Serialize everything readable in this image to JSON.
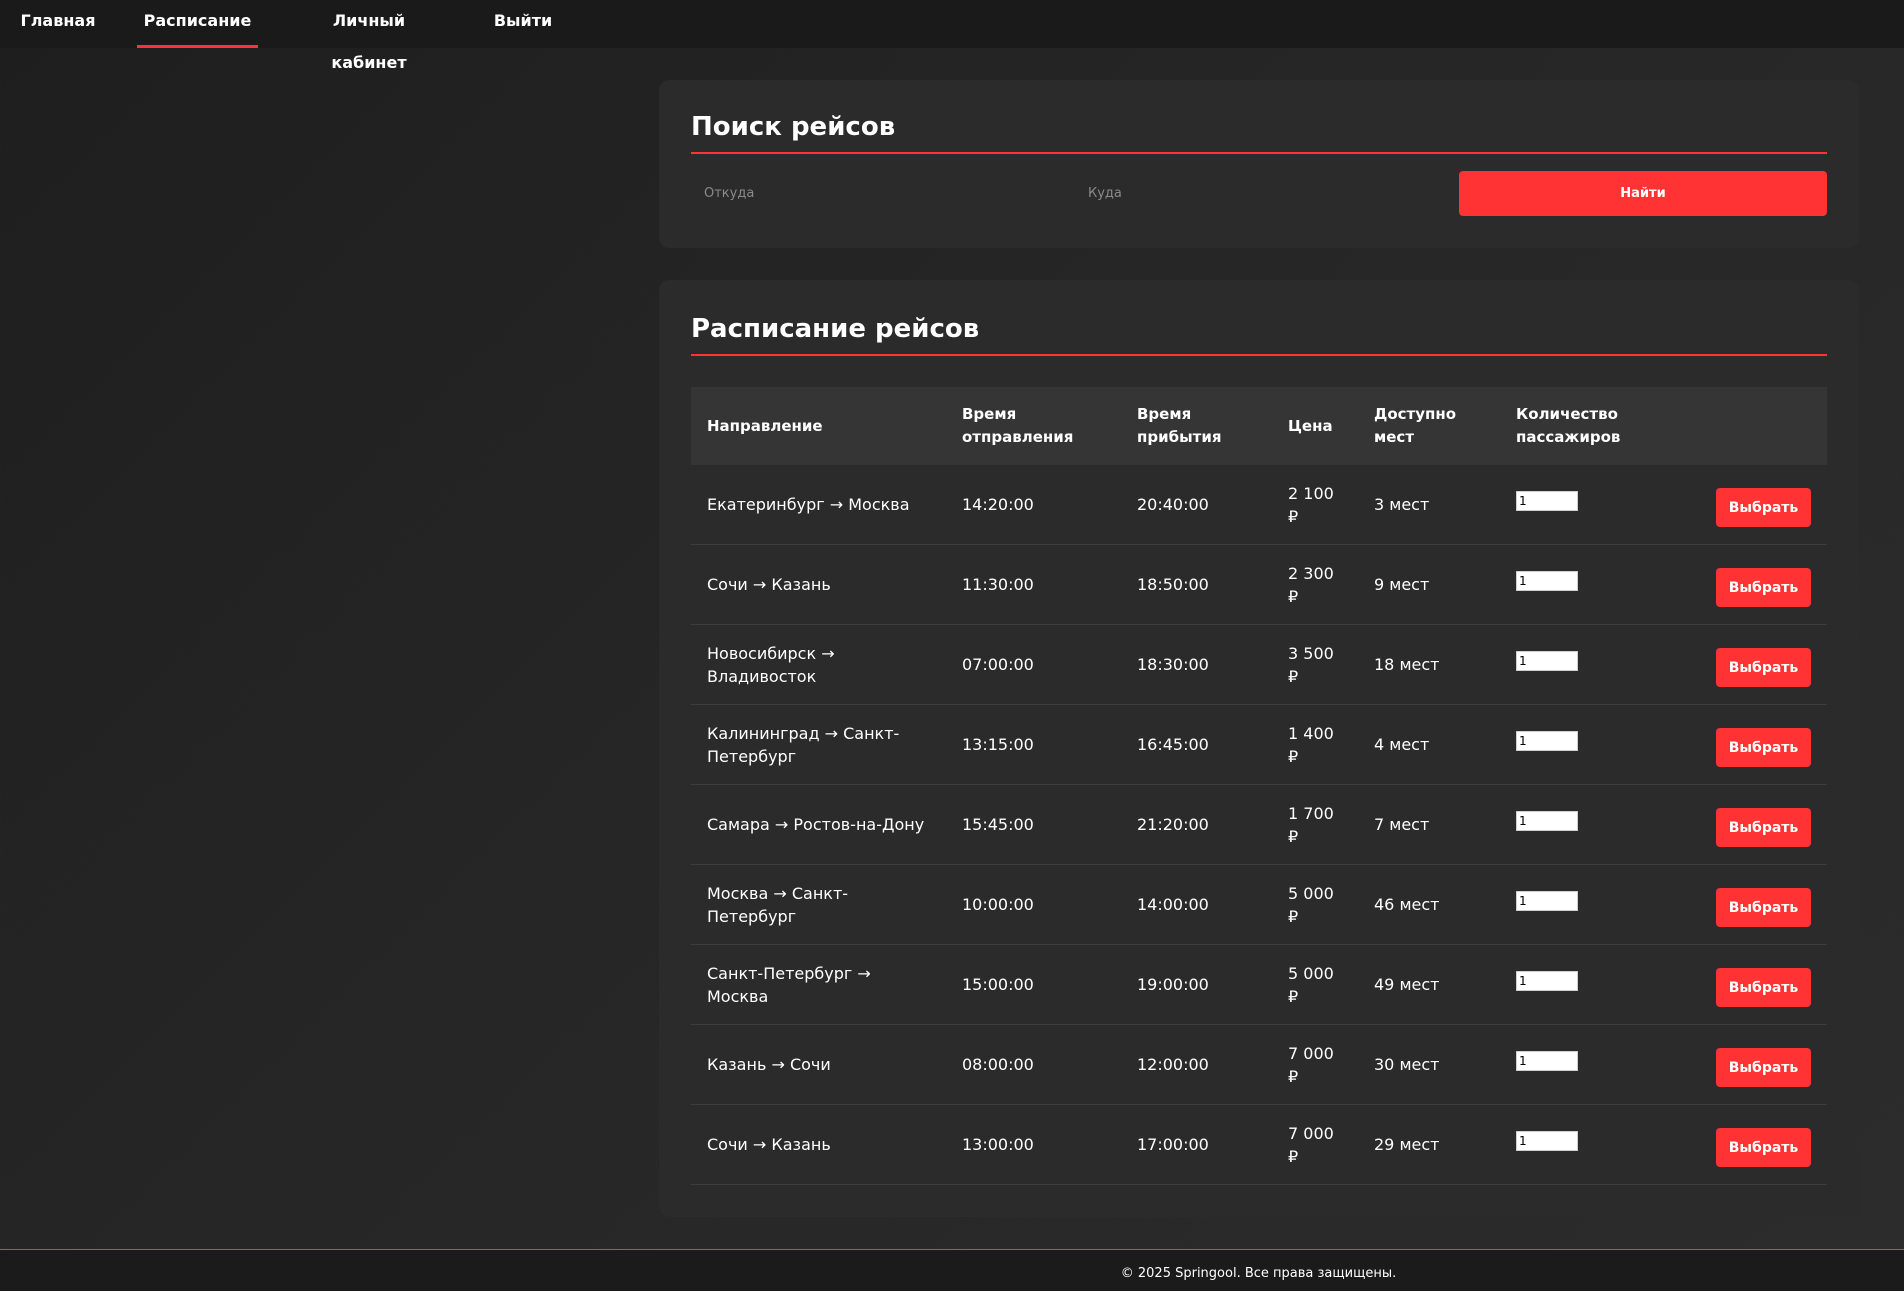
{
  "nav": {
    "items": [
      {
        "label": "Главная",
        "active": false
      },
      {
        "label": "Расписание",
        "active": true
      },
      {
        "label": "Личный кабинет",
        "active": false
      },
      {
        "label": "Выйти",
        "active": false
      }
    ]
  },
  "search": {
    "title": "Поиск рейсов",
    "from_placeholder": "Откуда",
    "from_value": "",
    "to_placeholder": "Куда",
    "to_value": "",
    "button_label": "Найти"
  },
  "schedule": {
    "title": "Расписание рейсов",
    "headers": [
      "Направление",
      "Время отправления",
      "Время прибытия",
      "Цена",
      "Доступно мест",
      "Количество пассажиров",
      ""
    ],
    "rows": [
      {
        "route": "Екатеринбург → Москва",
        "departure": "14:20:00",
        "arrival": "20:40:00",
        "price": "2 100 ₽",
        "seats": "3 мест",
        "qty": "1",
        "button": "Выбрать"
      },
      {
        "route": "Сочи → Казань",
        "departure": "11:30:00",
        "arrival": "18:50:00",
        "price": "2 300 ₽",
        "seats": "9 мест",
        "qty": "1",
        "button": "Выбрать"
      },
      {
        "route": "Новосибирск → Владивосток",
        "departure": "07:00:00",
        "arrival": "18:30:00",
        "price": "3 500 ₽",
        "seats": "18 мест",
        "qty": "1",
        "button": "Выбрать"
      },
      {
        "route": "Калининград → Санкт-Петербург",
        "departure": "13:15:00",
        "arrival": "16:45:00",
        "price": "1 400 ₽",
        "seats": "4 мест",
        "qty": "1",
        "button": "Выбрать"
      },
      {
        "route": "Самара → Ростов-на-Дону",
        "departure": "15:45:00",
        "arrival": "21:20:00",
        "price": "1 700 ₽",
        "seats": "7 мест",
        "qty": "1",
        "button": "Выбрать"
      },
      {
        "route": "Москва → Санкт-Петербург",
        "departure": "10:00:00",
        "arrival": "14:00:00",
        "price": "5 000 ₽",
        "seats": "46 мест",
        "qty": "1",
        "button": "Выбрать"
      },
      {
        "route": "Санкт-Петербург → Москва",
        "departure": "15:00:00",
        "arrival": "19:00:00",
        "price": "5 000 ₽",
        "seats": "49 мест",
        "qty": "1",
        "button": "Выбрать"
      },
      {
        "route": "Казань → Сочи",
        "departure": "08:00:00",
        "arrival": "12:00:00",
        "price": "7 000 ₽",
        "seats": "30 мест",
        "qty": "1",
        "button": "Выбрать"
      },
      {
        "route": "Сочи → Казань",
        "departure": "13:00:00",
        "arrival": "17:00:00",
        "price": "7 000 ₽",
        "seats": "29 мест",
        "qty": "1",
        "button": "Выбрать"
      }
    ]
  },
  "footer": {
    "text": "© 2025 Springool. Все права защищены."
  },
  "colors": {
    "accent": "#ff3333",
    "background": "#262626",
    "card": "#2b2b2b",
    "header_row": "#353535",
    "nav": "#1a1a1a"
  }
}
